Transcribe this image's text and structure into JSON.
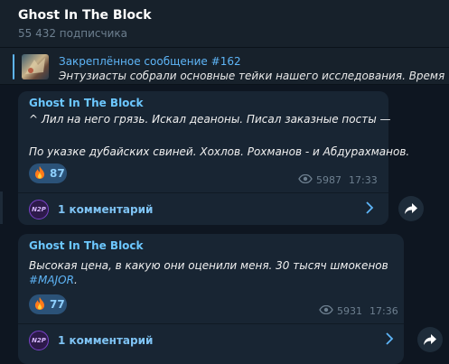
{
  "header": {
    "title": "Ghost In The Block",
    "subscribers": "55 432 подписчика"
  },
  "pinned": {
    "title": "Закреплённое сообщение #162",
    "text": "Энтузиасты собрали основные тейки нашего исследования.   Время ч"
  },
  "messages": [
    {
      "author": "Ghost In The Block",
      "line1": "^ Лил на него грязь. Искал деаноны. Писал заказные посты —",
      "line2": "По указке дубайских свиней. Хохлов. Рохманов - и Абдурахманов.",
      "reaction_count": "87",
      "views": "5987",
      "time": "17:33",
      "comments_label": "1 комментарий",
      "avatar_text": "N2P"
    },
    {
      "author": "Ghost In The Block",
      "line1": "Высокая цена, в какую они оценили меня. 30 тысяч шмокенов",
      "hashtag": "#MAJOR",
      "hashtag_suffix": ".",
      "reaction_count": "77",
      "views": "5931",
      "time": "17:36",
      "comments_label": "1 комментарий",
      "avatar_text": "N2P"
    }
  ],
  "icons": {
    "reaction": "fire-icon",
    "views": "eye-icon",
    "comments_arrow": "chevron-right-icon",
    "share": "share-arrow-icon"
  },
  "colors": {
    "background": "#0e1621",
    "panel": "#17212b",
    "bubble": "#182533",
    "accent": "#5eb5f7",
    "reaction_bg": "#2b5278",
    "muted": "#6d7f8f"
  }
}
